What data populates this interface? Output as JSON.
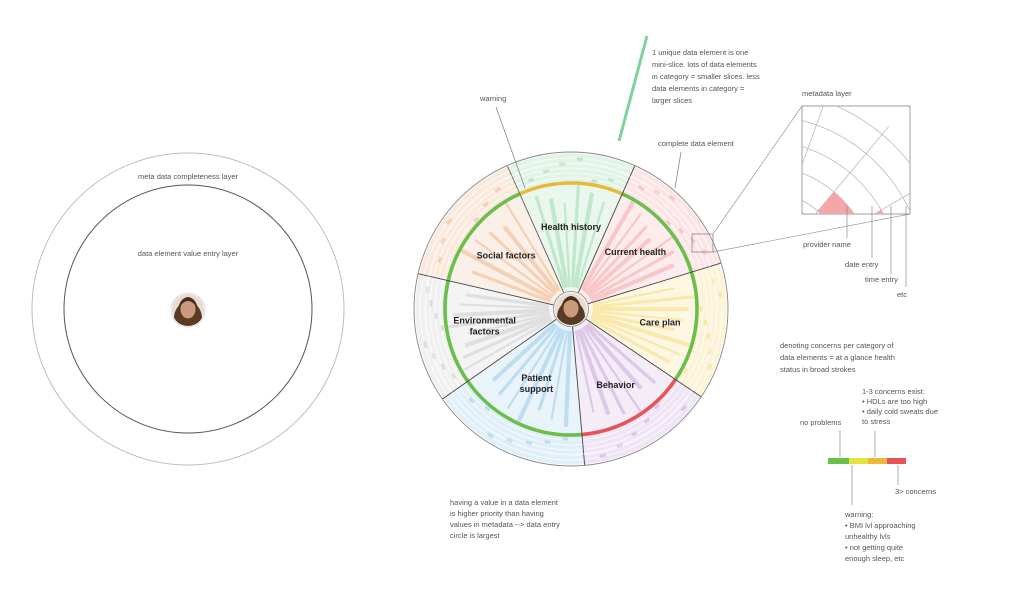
{
  "left_diagram": {
    "outer_label": "meta data completeness layer",
    "inner_label": "data element value entry layer",
    "avatar": "person-avatar"
  },
  "wheel": {
    "avatar": "person-avatar",
    "segments": [
      {
        "id": "health-history",
        "label_lines": [
          "Health history"
        ],
        "color": "#bfe6c9",
        "status_color": "#eab83a"
      },
      {
        "id": "current-health",
        "label_lines": [
          "Current health"
        ],
        "color": "#f9c5c8",
        "status_color": "#6abf4b"
      },
      {
        "id": "care-plan",
        "label_lines": [
          "Care plan"
        ],
        "color": "#fbe7a8",
        "status_color": "#6abf4b"
      },
      {
        "id": "behavior",
        "label_lines": [
          "Behavior"
        ],
        "color": "#dcc6e6",
        "status_color": "#e8525a"
      },
      {
        "id": "patient-support",
        "label_lines": [
          "Patient",
          "support"
        ],
        "color": "#bcdcef",
        "status_color": "#6abf4b"
      },
      {
        "id": "environmental-factors",
        "label_lines": [
          "Environmental",
          "factors"
        ],
        "color": "#dddddd",
        "status_color": "#6abf4b"
      },
      {
        "id": "social-factors",
        "label_lines": [
          "Social factors"
        ],
        "color": "#f3cfb3",
        "status_color": "#6abf4b"
      }
    ]
  },
  "annotations": {
    "mini_slice_note": [
      "1 unique data element is one",
      "mini-slice. lots of data elements",
      "in category = smaller slices. less",
      "data elements in category =",
      "larger slices"
    ],
    "warning": "warning",
    "complete_data_element": "complete data element",
    "metadata_layer": "metadata layer",
    "provider_name": "provider name",
    "date_entry": "date entry",
    "time_entry": "time entry",
    "etc": "etc",
    "concerns_note": [
      "denoting concerns per category of",
      "data elements = at a glance health",
      "status in broad strokes"
    ],
    "priority_note": [
      "having a value in a data element",
      "is higher priority than having",
      "values in metadata --> data entry",
      "circle is largest"
    ]
  },
  "legend": {
    "colors": [
      "#6abf4b",
      "#e3e33b",
      "#eab83a",
      "#e8525a"
    ],
    "no_problems": "no problems",
    "concerns_1_3": [
      "1-3 concerns exist:",
      "• HDLs are too high",
      "• daily cold sweats due",
      "to stress"
    ],
    "concerns_3plus": "3> concerns",
    "warning_detail": [
      "warning:",
      "• BMI lvl approaching",
      "unhealthy lvls",
      "• not getting quite",
      "enough sleep, etc"
    ]
  }
}
